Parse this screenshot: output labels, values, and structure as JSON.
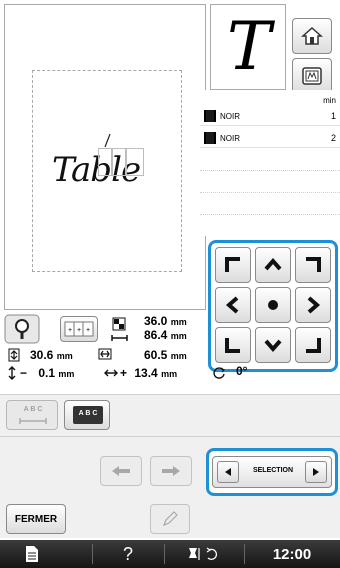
{
  "preview": {
    "text": "Table"
  },
  "character_preview": {
    "glyph": "T"
  },
  "color_list": {
    "min_label": "min",
    "rows": [
      {
        "name": "NOIR",
        "minutes": "1"
      },
      {
        "name": "NOIR",
        "minutes": "2"
      }
    ]
  },
  "pattern_info": {
    "height_value": "36.0",
    "width_value": "86.4",
    "unit": "mm",
    "vertical_size_value": "30.6",
    "horizontal_size_value": "60.5",
    "vertical_offset_sign": "−",
    "vertical_offset_value": "0.1",
    "horizontal_offset_sign": "+",
    "horizontal_offset_value": "13.4",
    "rotation_value": "0°"
  },
  "lower_panel": {
    "array_horizontal_label": "A B C",
    "array_selected_label": "A B C",
    "selection_label": "SELECTION",
    "close_label": "FERMER"
  },
  "bottom_bar": {
    "time": "12:00",
    "help_label": "?"
  },
  "colors": {
    "accent_highlight": "#1e90d6",
    "bottom_bar": "#1f1f1f"
  }
}
